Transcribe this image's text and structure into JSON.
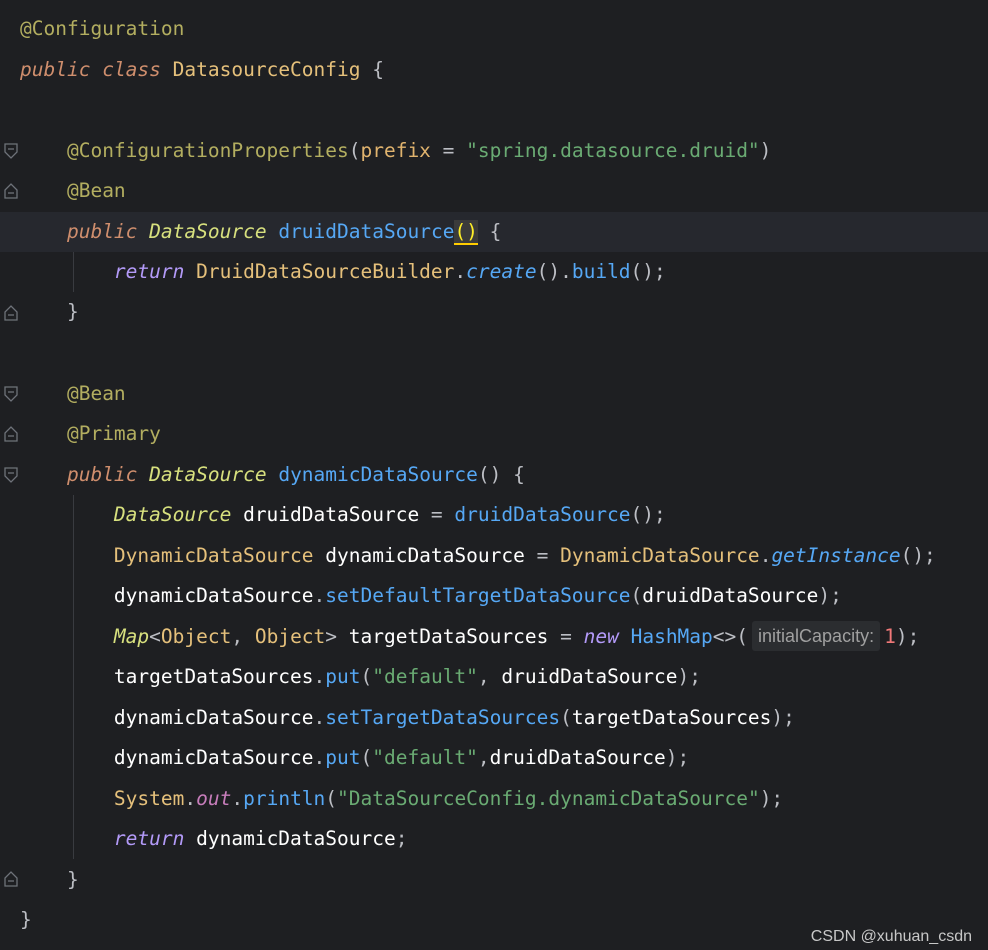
{
  "editor": {
    "language": "java",
    "lines": [
      {
        "annotation": "@Configuration"
      },
      {
        "kw_public": "public",
        "kw_class": "class",
        "class_name": "DatasourceConfig",
        "brace": "{"
      },
      {},
      {
        "annotation": "@ConfigurationProperties",
        "open": "(",
        "param": "prefix",
        "eq": " = ",
        "string": "\"spring.datasource.druid\"",
        "close": ")"
      },
      {
        "annotation": "@Bean"
      },
      {
        "kw_public": "public",
        "type": "DataSource",
        "method": "druidDataSource",
        "parens": "()",
        "brace": "{"
      },
      {
        "kw_return": "return",
        "class_name": "DruidDataSourceBuilder",
        "dot1": ".",
        "method1": "create",
        "p1": "()",
        "dot2": ".",
        "method2": "build",
        "p2": "();"
      },
      {
        "brace": "}"
      },
      {},
      {
        "annotation": "@Bean"
      },
      {
        "annotation": "@Primary"
      },
      {
        "kw_public": "public",
        "type": "DataSource",
        "method": "dynamicDataSource",
        "parens": "()",
        "brace": "{"
      },
      {
        "type": "DataSource",
        "var": "druidDataSource",
        "eq": " = ",
        "method": "druidDataSource",
        "tail": "();"
      },
      {
        "class_name": "DynamicDataSource",
        "var": "dynamicDataSource",
        "eq": " = ",
        "class_name2": "DynamicDataSource",
        "dot": ".",
        "method": "getInstance",
        "tail": "();"
      },
      {
        "var": "dynamicDataSource",
        "dot": ".",
        "method": "setDefaultTargetDataSource",
        "open": "(",
        "arg": "druidDataSource",
        "tail": ");"
      },
      {
        "iface": "Map",
        "lt": "<",
        "t1": "Object",
        "comma": ", ",
        "t2": "Object",
        "gt": ">",
        "var": " targetDataSources",
        "eq": " = ",
        "kw_new": "new",
        "class_name": "HashMap",
        "diamond": "<>(",
        "hint": "initialCapacity:",
        "num": "1",
        "tail": ");"
      },
      {
        "var": "targetDataSources",
        "dot": ".",
        "method": "put",
        "open": "(",
        "string": "\"default\"",
        "comma": ", ",
        "arg": "druidDataSource",
        "tail": ");"
      },
      {
        "var": "dynamicDataSource",
        "dot": ".",
        "method": "setTargetDataSources",
        "open": "(",
        "arg": "targetDataSources",
        "tail": ");"
      },
      {
        "var": "dynamicDataSource",
        "dot": ".",
        "method": "put",
        "open": "(",
        "string": "\"default\"",
        "comma": ",",
        "arg": "druidDataSource",
        "tail": ");"
      },
      {
        "class_name": "System",
        "dot": ".",
        "field": "out",
        "dot2": ".",
        "method": "println",
        "open": "(",
        "string": "\"DataSourceConfig.dynamicDataSource\"",
        "tail": ");"
      },
      {
        "kw_return": "return",
        "var": "dynamicDataSource",
        "tail": ";"
      },
      {
        "brace": "}"
      },
      {
        "brace": "}"
      }
    ]
  },
  "watermark": "CSDN @xuhuan_csdn",
  "colors": {
    "background": "#1e1f22",
    "current_line": "#26282e",
    "annotation": "#b3ae60",
    "keyword": "#cf8e6d",
    "class": "#e5c07b",
    "method": "#56a8f5",
    "string": "#6aab73"
  }
}
